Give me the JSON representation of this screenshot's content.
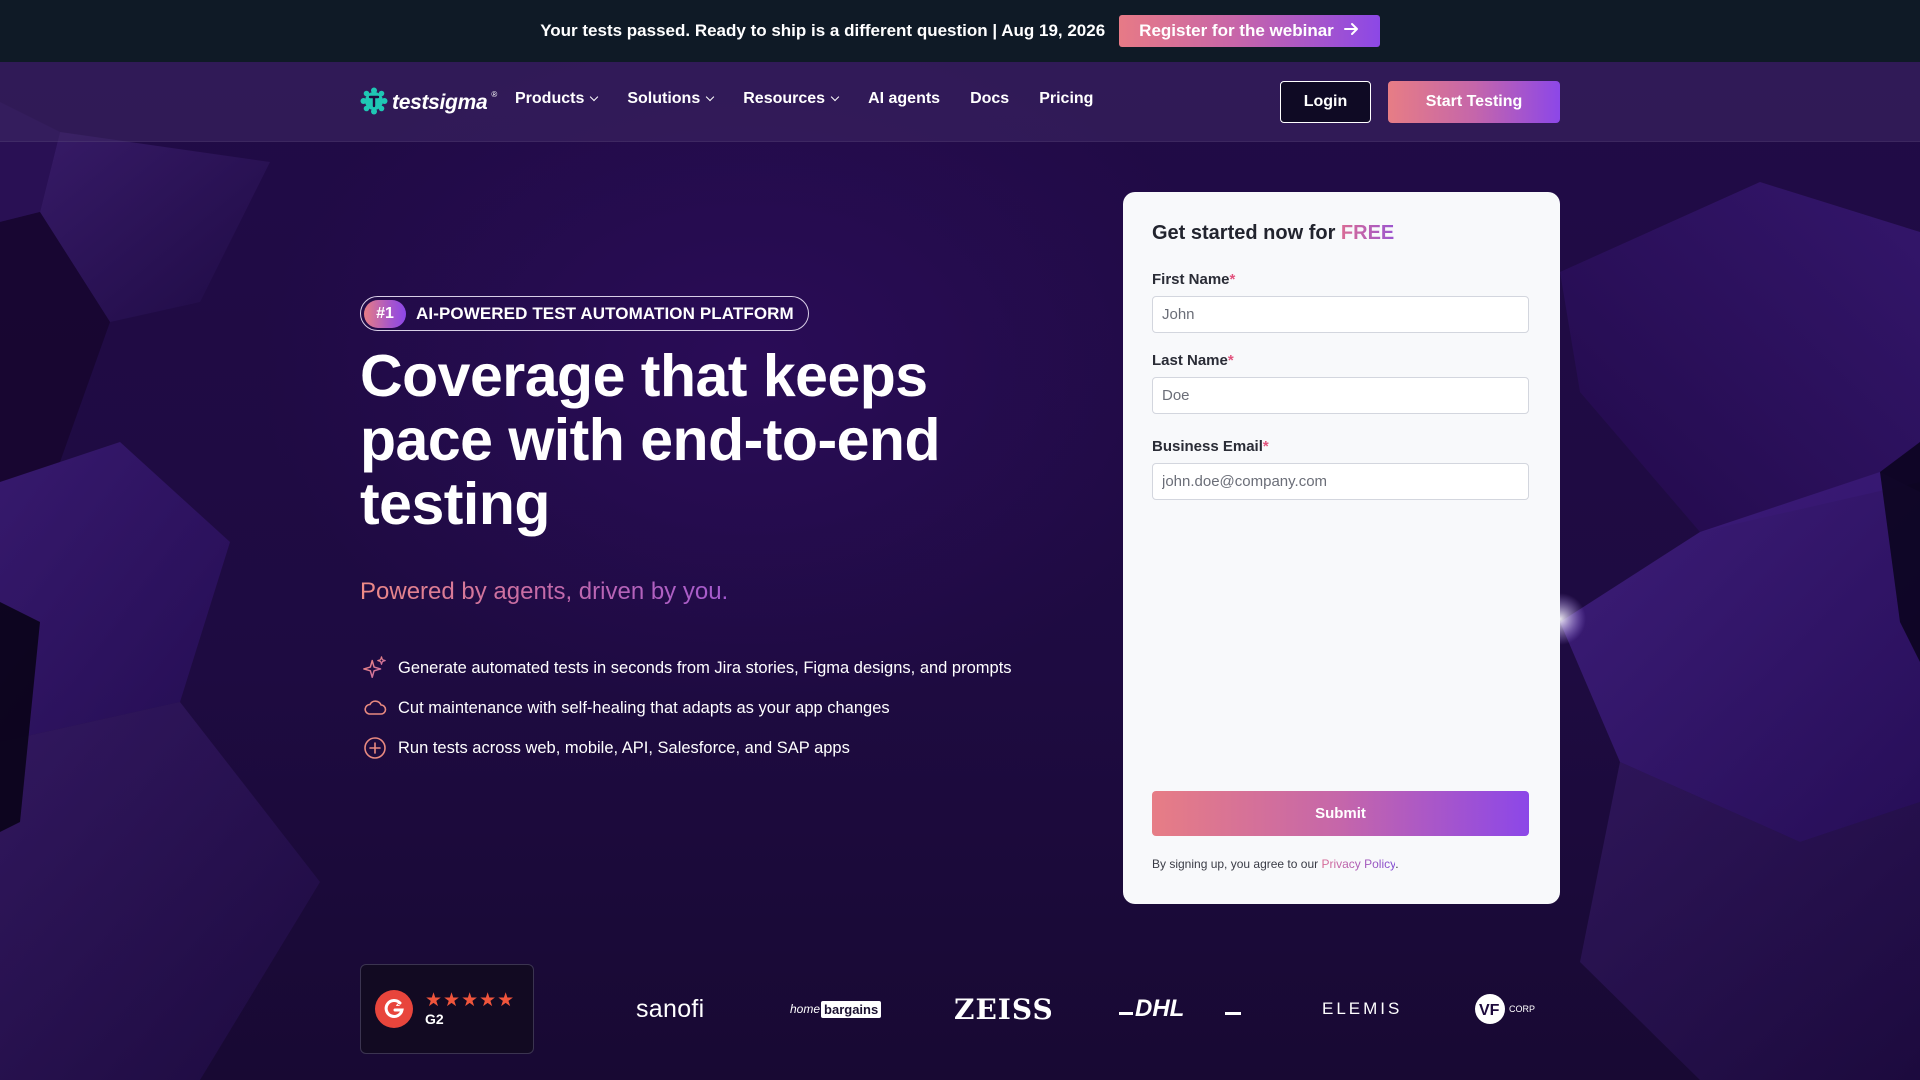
{
  "announcement": {
    "text": "Your tests passed. Ready to ship is a different question | Aug 19, 2026",
    "button_label": "Register for the webinar"
  },
  "nav": {
    "logo": "testsigma",
    "items": [
      {
        "label": "Products",
        "dropdown": true
      },
      {
        "label": "Solutions",
        "dropdown": true
      },
      {
        "label": "Resources",
        "dropdown": true
      },
      {
        "label": "AI agents",
        "dropdown": false
      },
      {
        "label": "Docs",
        "dropdown": false
      },
      {
        "label": "Pricing",
        "dropdown": false
      }
    ],
    "login_label": "Login",
    "start_label": "Start Testing"
  },
  "hero": {
    "badge_number": "#1",
    "badge_text": "AI-POWERED TEST AUTOMATION PLATFORM",
    "headline": "Coverage that keeps pace with end-to-end testing",
    "tagline": "Powered by agents, driven by you.",
    "features": [
      {
        "icon": "sparkle-icon",
        "text": "Generate automated tests in seconds from Jira stories, Figma designs, and prompts"
      },
      {
        "icon": "cloud-icon",
        "text": "Cut maintenance with self-healing that adapts as your app changes"
      },
      {
        "icon": "plus-circle-icon",
        "text": "Run tests across web, mobile, API, Salesforce, and SAP apps"
      }
    ]
  },
  "form": {
    "title": "Get started now for ",
    "title_highlight": "FREE",
    "fields": {
      "first_name": {
        "label": "First Name",
        "required_mark": "*",
        "placeholder": "John",
        "value": ""
      },
      "last_name": {
        "label": "Last Name",
        "required_mark": "*",
        "placeholder": "Doe",
        "value": ""
      },
      "email": {
        "label": "Business Email",
        "required_mark": "*",
        "placeholder": "john.doe@company.com",
        "value": ""
      }
    },
    "submit_label": "Submit",
    "legal_text": "By signing up, you agree to our ",
    "legal_link": "Privacy Policy",
    "legal_end": "."
  },
  "trust": {
    "g2_label": "G2",
    "g2_stars": "★★★★★",
    "g2_rating": 4.5,
    "brands": {
      "sanofi": "sanofi",
      "home": "home",
      "bargains": "bargains",
      "zeiss": "ZEISS",
      "dhl": "DHL",
      "elemis": "ELEMIS",
      "vf": "CORP"
    }
  },
  "colors": {
    "accent_start": "#e77d85",
    "accent_end": "#8c47e8",
    "background": "#1d0a3d",
    "topbar": "#0f1a26"
  }
}
